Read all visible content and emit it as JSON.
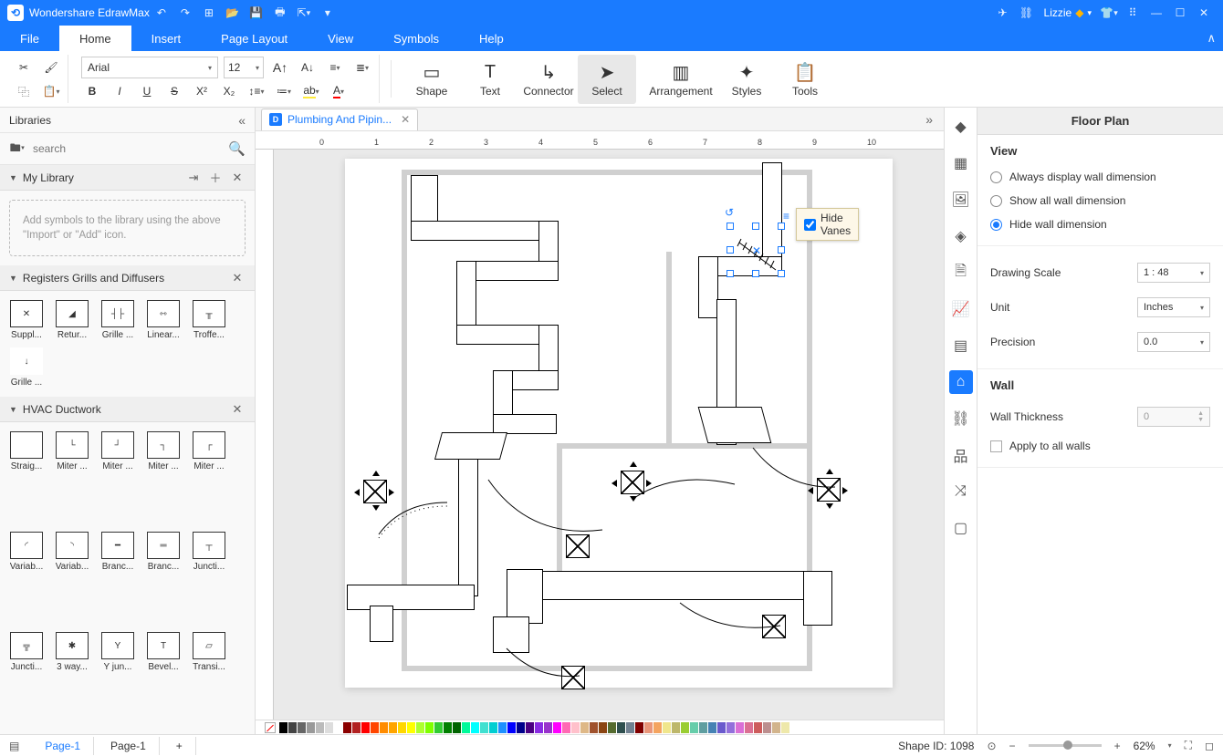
{
  "app_title": "Wondershare EdrawMax",
  "user_name": "Lizzie",
  "menu": [
    "File",
    "Home",
    "Insert",
    "Page Layout",
    "View",
    "Symbols",
    "Help"
  ],
  "active_menu": "Home",
  "font": {
    "name": "Arial",
    "size": "12"
  },
  "ribbon_big": {
    "shape": "Shape",
    "text": "Text",
    "connector": "Connector",
    "select": "Select",
    "arrangement": "Arrangement",
    "styles": "Styles",
    "tools": "Tools"
  },
  "doc_tab": "Plumbing And Pipin...",
  "left": {
    "header": "Libraries",
    "search_placeholder": "search",
    "sections": {
      "mylib": {
        "title": "My Library",
        "hint": "Add symbols to the library using the above \"Import\" or \"Add\" icon."
      },
      "registers": {
        "title": "Registers Grills and Diffusers",
        "items": [
          "Suppl...",
          "Retur...",
          "Grille ...",
          "Linear...",
          "Troffe...",
          "Grille ..."
        ]
      },
      "ductwork": {
        "title": "HVAC Ductwork",
        "items": [
          "Straig...",
          "Miter ...",
          "Miter ...",
          "Miter ...",
          "Miter ...",
          "Variab...",
          "Variab...",
          "Branc...",
          "Branc...",
          "Juncti...",
          "Juncti...",
          "3 way...",
          "Y jun...",
          "Bevel...",
          "Transi..."
        ]
      }
    }
  },
  "context_popup": "Hide Vanes",
  "ruler_marks": [
    "0",
    "1",
    "2",
    "3",
    "4",
    "5",
    "6",
    "7",
    "8",
    "9",
    "10"
  ],
  "right": {
    "title": "Floor Plan",
    "view_label": "View",
    "radios": [
      "Always display wall dimension",
      "Show all wall dimension",
      "Hide wall dimension"
    ],
    "radio_selected": 2,
    "drawing_scale_label": "Drawing Scale",
    "drawing_scale_value": "1 : 48",
    "unit_label": "Unit",
    "unit_value": "Inches",
    "precision_label": "Precision",
    "precision_value": "0.0",
    "wall_label": "Wall",
    "wall_thickness_label": "Wall Thickness",
    "wall_thickness_value": "0",
    "apply_all_label": "Apply to all walls"
  },
  "status": {
    "pages": [
      "Page-1",
      "Page-1"
    ],
    "add": "+",
    "shape_id_label": "Shape ID:",
    "shape_id_value": "1098",
    "zoom": "62%"
  },
  "color_strip": [
    "#000000",
    "#444444",
    "#666666",
    "#999999",
    "#bbbbbb",
    "#dddddd",
    "#ffffff",
    "#8b0000",
    "#b22222",
    "#ff0000",
    "#ff4500",
    "#ff8c00",
    "#ffa500",
    "#ffd700",
    "#ffff00",
    "#adff2f",
    "#7fff00",
    "#32cd32",
    "#008000",
    "#006400",
    "#00fa9a",
    "#00ffff",
    "#40e0d0",
    "#00ced1",
    "#1e90ff",
    "#0000ff",
    "#00008b",
    "#4b0082",
    "#8a2be2",
    "#9932cc",
    "#ff00ff",
    "#ff69b4",
    "#ffc0cb",
    "#deb887",
    "#a0522d",
    "#8b4513",
    "#556b2f",
    "#2f4f4f",
    "#708090",
    "#800000",
    "#e9967a",
    "#f4a460",
    "#f0e68c",
    "#bdb76b",
    "#9acd32",
    "#66cdaa",
    "#5f9ea0",
    "#4682b4",
    "#6a5acd",
    "#9370db",
    "#da70d6",
    "#db7093",
    "#cd5c5c",
    "#bc8f8f",
    "#d2b48c",
    "#eee8aa"
  ]
}
